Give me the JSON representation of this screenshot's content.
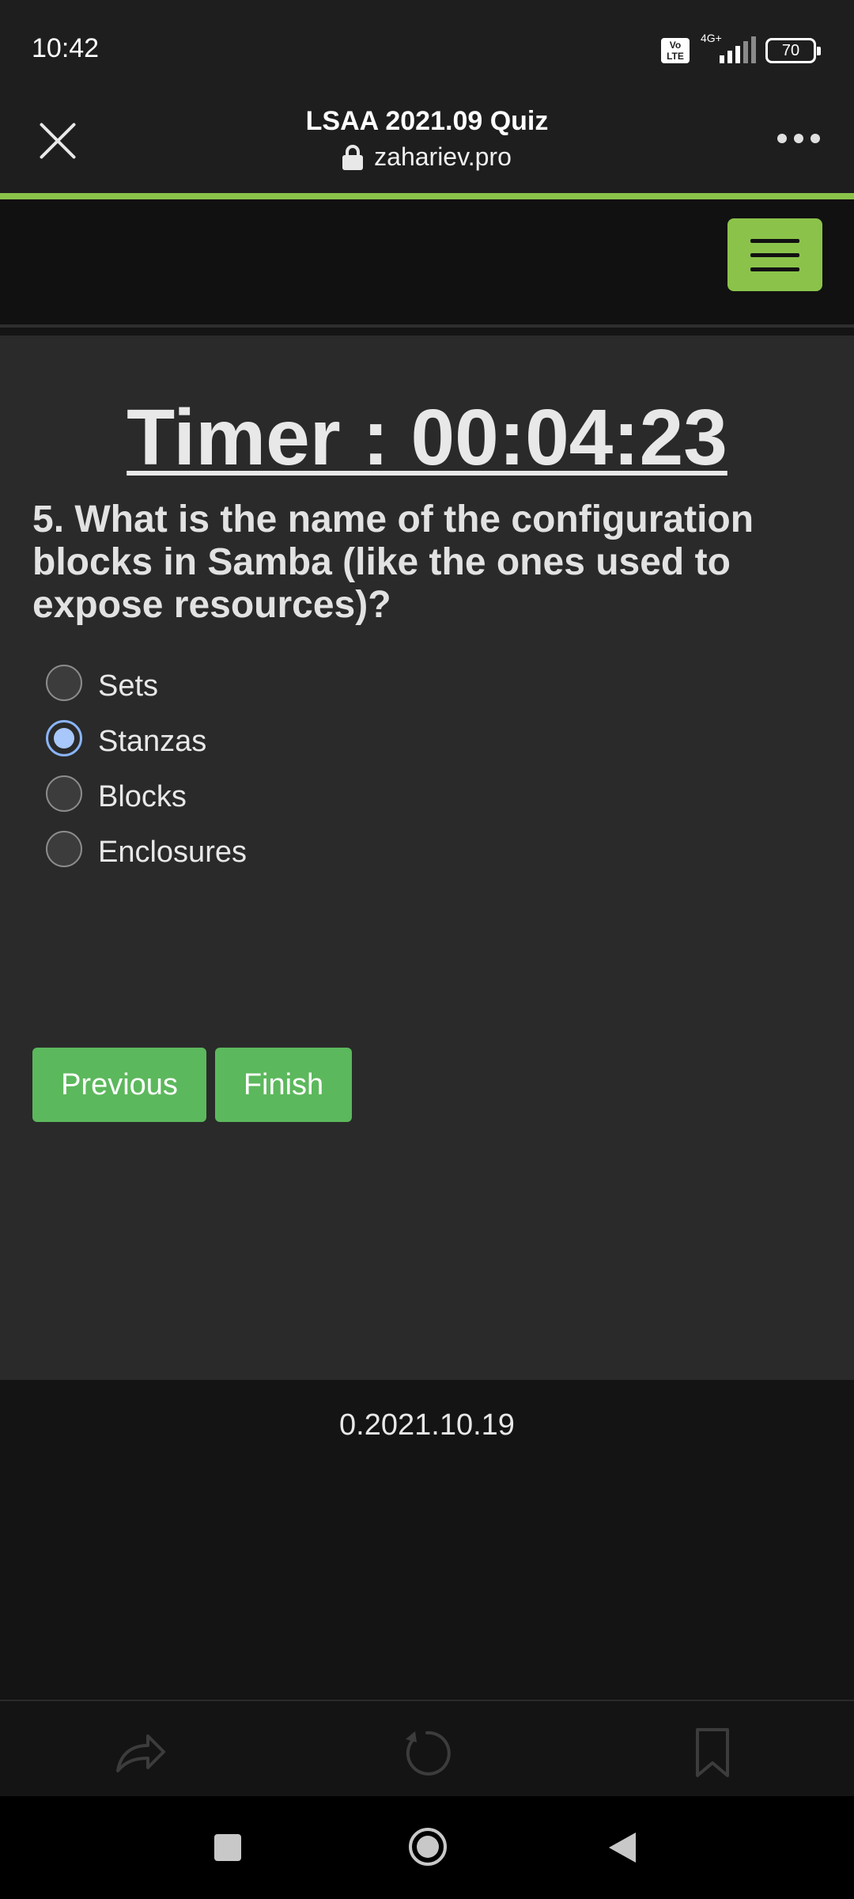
{
  "status_bar": {
    "time": "10:42",
    "volte_line1": "Vo",
    "volte_line2": "LTE",
    "network": "4G+",
    "battery": "70"
  },
  "browser": {
    "title": "LSAA 2021.09 Quiz",
    "url": "zahariev.pro",
    "accent_color": "#8bc34a"
  },
  "quiz": {
    "timer": "Timer : 00:04:23",
    "question": "5. What is the name of the configuration blocks in Samba (like the ones used to expose resources)?",
    "options": [
      {
        "label": "Sets",
        "selected": false
      },
      {
        "label": "Stanzas",
        "selected": true
      },
      {
        "label": "Blocks",
        "selected": false
      },
      {
        "label": "Enclosures",
        "selected": false
      }
    ],
    "previous_label": "Previous",
    "finish_label": "Finish",
    "button_color": "#5cb85c"
  },
  "footer": {
    "version": "0.2021.10.19"
  },
  "icons": {
    "close": "close-icon",
    "lock": "lock-icon",
    "more": "more-icon",
    "menu": "hamburger-menu-icon",
    "share": "share-icon",
    "refresh": "refresh-icon",
    "bookmark": "bookmark-icon",
    "recents": "recents-icon",
    "home": "home-icon",
    "back": "back-icon"
  }
}
